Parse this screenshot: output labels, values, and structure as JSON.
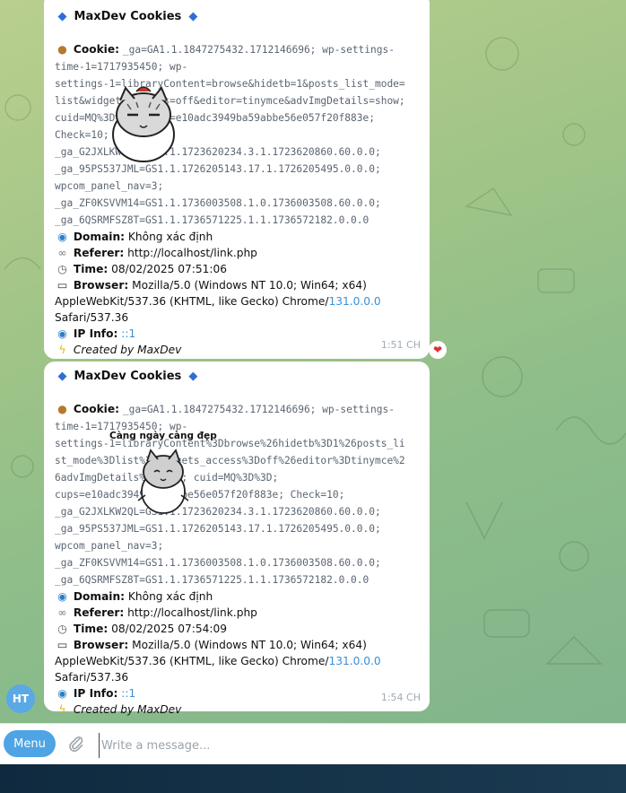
{
  "messages": [
    {
      "title": "MaxDev Cookies",
      "cookie_label": "Cookie:",
      "cookie_lines": [
        "_ga=GA1.1.1847275432.1712146696; wp-settings-",
        "time-1=1717935450; wp-",
        "settings-1=libraryContent=browse&hidetb=1&posts_list_mode=",
        "list&widgets_access=off&editor=tinymce&advImgDetails=show;",
        "cuid=MQ%3D%3D; cups=e10adc3949ba59abbe56e057f20f883e;",
        "Check=10;",
        "_ga_G2JXLKW2QL=GS1.1.1723620234.3.1.1723620860.60.0.0;",
        "_ga_95PS537JML=GS1.1.1726205143.17.1.1726205495.0.0.0;",
        "wpcom_panel_nav=3;",
        "_ga_ZF0KSVVM14=GS1.1.1736003508.1.0.1736003508.60.0.0;",
        "_ga_6QSRMFSZ8T=GS1.1.1736571225.1.1.1736572182.0.0.0"
      ],
      "domain_label": "Domain:",
      "domain_value": "Không xác định",
      "referer_label": "Referer:",
      "referer_value": "http://localhost/link.php",
      "time_label": "Time:",
      "time_value": "08/02/2025 07:51:06",
      "browser_label": "Browser:",
      "browser_line1": "Mozilla/5.0 (Windows NT 10.0; Win64; x64)",
      "browser_line2_prefix": "AppleWebKit/537.36 (KHTML, like Gecko) Chrome/",
      "browser_version": "131.0.0.0",
      "browser_line3": "Safari/537.36",
      "ip_label": "IP Info:",
      "ip_value": "::1",
      "created_by": "Created by MaxDev",
      "timestamp": "1:51 CH",
      "reaction": "heart"
    },
    {
      "title": "MaxDev Cookies",
      "cookie_label": "Cookie:",
      "cookie_lines": [
        "_ga=GA1.1.1847275432.1712146696; wp-settings-",
        "time-1=1717935450; wp-",
        "settings-1=libraryContent%3Dbrowse%26hidetb%3D1%26posts_li",
        "st_mode%3Dlist%26widgets_access%3Doff%26editor%3Dtinymce%2",
        "6advImgDetails%3Dshow; cuid=MQ%3D%3D;",
        "cups=e10adc3949ba59abbe56e057f20f883e; Check=10;",
        "_ga_G2JXLKW2QL=GS1.1.1723620234.3.1.1723620860.60.0.0;",
        "_ga_95PS537JML=GS1.1.1726205143.17.1.1726205495.0.0.0;",
        "wpcom_panel_nav=3;",
        "_ga_ZF0KSVVM14=GS1.1.1736003508.1.0.1736003508.60.0.0;",
        "_ga_6QSRMFSZ8T=GS1.1.1736571225.1.1.1736572182.0.0.0"
      ],
      "domain_label": "Domain:",
      "domain_value": "Không xác định",
      "referer_label": "Referer:",
      "referer_value": "http://localhost/link.php",
      "time_label": "Time:",
      "time_value": "08/02/2025 07:54:09",
      "browser_label": "Browser:",
      "browser_line1": "Mozilla/5.0 (Windows NT 10.0; Win64; x64)",
      "browser_line2_prefix": "AppleWebKit/537.36 (KHTML, like Gecko) Chrome/",
      "browser_version": "131.0.0.0",
      "browser_line3": "Safari/537.36",
      "ip_label": "IP Info:",
      "ip_value": "::1",
      "created_by": "Created by MaxDev",
      "timestamp": "1:54 CH"
    }
  ],
  "sticker2_caption": "Càng ngày càng đẹp",
  "avatar_initials": "HT",
  "composer": {
    "menu_label": "Menu",
    "placeholder": "Write a message..."
  },
  "colors": {
    "link": "#3a8fd6",
    "accent": "#4ea4e4",
    "heart": "#e0303a"
  },
  "icons": [
    "diamond-icon",
    "cookie-icon",
    "globe-icon",
    "link-icon",
    "clock-icon",
    "monitor-icon",
    "lightning-icon",
    "paperclip-icon",
    "heart-icon"
  ]
}
